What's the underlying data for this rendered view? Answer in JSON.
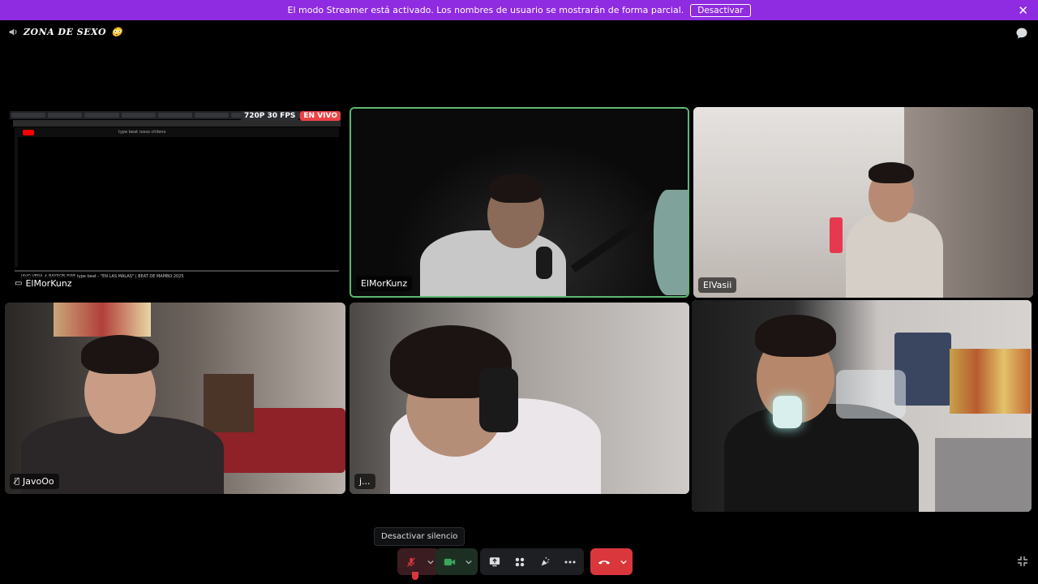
{
  "banner": {
    "message": "El modo Streamer está activado. Los nombres de usuario se mostrarán de forma parcial.",
    "button_label": "Desactivar",
    "close_icon": "close-icon"
  },
  "channel": {
    "name": "ZONA DE SEXO",
    "emoji": "😳",
    "icon": "speaker-icon"
  },
  "stream": {
    "quality": "720P 30 FPS",
    "live_label": "EN VIVO",
    "video_title": "JAVO VERA ✗ BAYRON FIRE type beat - \"EN LAS MALAS\" | BEAT DE MAMBO 2025",
    "search_text": "type beat rosso chileno"
  },
  "tiles": [
    {
      "name": "ElMorKunz",
      "type": "screenshare"
    },
    {
      "name": "ElMorKunz",
      "type": "camera",
      "speaking": true
    },
    {
      "name": "ElVasii",
      "type": "camera"
    },
    {
      "name": "JavoOo",
      "type": "camera",
      "muted": true
    },
    {
      "name": "j...",
      "type": "camera"
    },
    {
      "name": "",
      "type": "camera"
    }
  ],
  "controls": {
    "tooltip": "Desactivar silencio",
    "accent_mute": "#da373c",
    "accent_cam": "#3ba55c",
    "accent_hangup": "#da373c"
  }
}
